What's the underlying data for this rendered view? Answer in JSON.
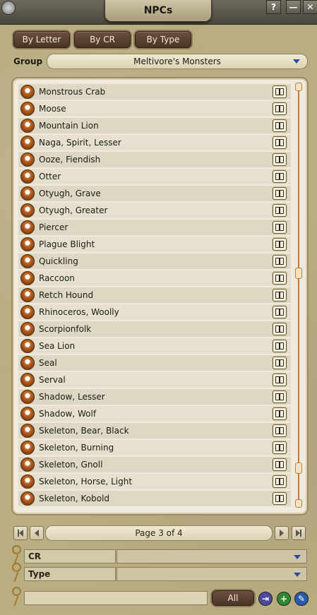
{
  "window": {
    "title": "NPCs",
    "help_label": "?",
    "minimize_label": "—",
    "close_label": "✕"
  },
  "tabs": [
    {
      "label": "By Letter"
    },
    {
      "label": "By CR"
    },
    {
      "label": "By Type"
    }
  ],
  "group": {
    "label": "Group",
    "value": "Meltivore's Monsters"
  },
  "npcs": [
    "Monstrous Crab",
    "Moose",
    "Mountain Lion",
    "Naga, Spirit, Lesser",
    "Ooze, Fiendish",
    "Otter",
    "Otyugh, Grave",
    "Otyugh, Greater",
    "Piercer",
    "Plague Blight",
    "Quickling",
    "Raccoon",
    "Retch Hound",
    "Rhinoceros, Woolly",
    "Scorpionfolk",
    "Sea Lion",
    "Seal",
    "Serval",
    "Shadow, Lesser",
    "Shadow, Wolf",
    "Skeleton, Bear, Black",
    "Skeleton, Burning",
    "Skeleton, Gnoll",
    "Skeleton, Horse, Light",
    "Skeleton, Kobold"
  ],
  "pager": {
    "text": "Page 3 of 4"
  },
  "filters": [
    {
      "label": "CR",
      "value": ""
    },
    {
      "label": "Type",
      "value": ""
    }
  ],
  "footer": {
    "all_label": "All",
    "search_value": ""
  },
  "colors": {
    "accent_brown": "#4a3428",
    "add_green": "#2f8a2f",
    "edit_blue": "#2a5aa8",
    "import_purple": "#4a4aa0"
  }
}
